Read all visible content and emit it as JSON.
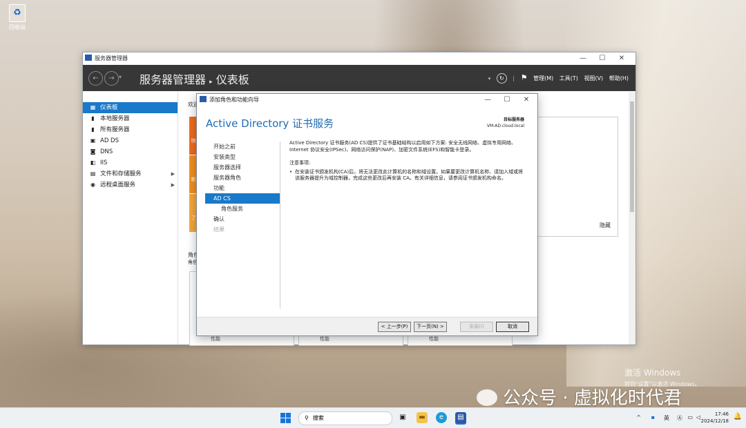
{
  "desktop": {
    "recycle_bin_label": "回收站"
  },
  "server_manager": {
    "window_title": "服务器管理器",
    "breadcrumb_app": "服务器管理器",
    "breadcrumb_sep": "▸",
    "breadcrumb_page": "仪表板",
    "menus": [
      "管理(M)",
      "工具(T)",
      "视图(V)",
      "帮助(H)"
    ],
    "nav_items": [
      {
        "label": "仪表板",
        "icon": "dashboard-icon",
        "glyph": "▦",
        "active": true
      },
      {
        "label": "本地服务器",
        "icon": "server-icon",
        "glyph": "▮"
      },
      {
        "label": "所有服务器",
        "icon": "servers-icon",
        "glyph": "▮"
      },
      {
        "label": "AD DS",
        "icon": "adds-icon",
        "glyph": "▣"
      },
      {
        "label": "DNS",
        "icon": "dns-icon",
        "glyph": "◙"
      },
      {
        "label": "IIS",
        "icon": "iis-icon",
        "glyph": "◧"
      },
      {
        "label": "文件和存储服务",
        "icon": "storage-icon",
        "glyph": "▤",
        "expand": true
      },
      {
        "label": "远程桌面服务",
        "icon": "remote-desktop-icon",
        "glyph": "◉",
        "expand": true
      }
    ],
    "welcome_text": "欢迎",
    "quick_tiles": [
      "快",
      "新",
      "了"
    ],
    "hide_label": "隐藏",
    "roles_heading": "角色",
    "roles_sub": "角色",
    "tile_footer": [
      "性能",
      "性能",
      "性能"
    ]
  },
  "wizard": {
    "title": "添加角色和功能向导",
    "heading": "Active Directory 证书服务",
    "target_label": "目标服务器",
    "target_value": "VM-AD.cloud.local",
    "steps": [
      {
        "label": "开始之前",
        "state": "normal"
      },
      {
        "label": "安装类型",
        "state": "normal"
      },
      {
        "label": "服务器选择",
        "state": "normal"
      },
      {
        "label": "服务器角色",
        "state": "normal"
      },
      {
        "label": "功能",
        "state": "normal"
      },
      {
        "label": "AD CS",
        "state": "active"
      },
      {
        "label": "角色服务",
        "state": "sub"
      },
      {
        "label": "确认",
        "state": "normal"
      },
      {
        "label": "结果",
        "state": "disabled"
      }
    ],
    "description": "Active Directory 证书服务(AD CS)提供了证书基础结构以启用如下方案: 安全无线网络、虚拟专用网络、Internet 协议安全(IPSec)、网络访问保护(NAP)、加密文件系统(EFS)和智能卡登录。",
    "notes_heading": "注意事项:",
    "note_1": "在安装证书颁发机构(CA)后，将无法更改此计算机的名称和域设置。如果要更改计算机名称、请加入域或将该服务器提升为域控制器，完成这些更改后再安装 CA。有关详细信息，请参阅证书颁发机构命名。",
    "buttons": {
      "prev": "< 上一步(P)",
      "next": "下一页(N) >",
      "install": "安装(I)",
      "cancel": "取消"
    }
  },
  "watermark": {
    "activate_title": "激活 Windows",
    "activate_sub": "转到\"设置\"以激活 Windows。",
    "wechat_text": "公众号 · 虚拟化时代君"
  },
  "taskbar": {
    "search_placeholder": "搜索",
    "ime_label": "英",
    "time": "17:46",
    "date": "2024/12/18"
  }
}
